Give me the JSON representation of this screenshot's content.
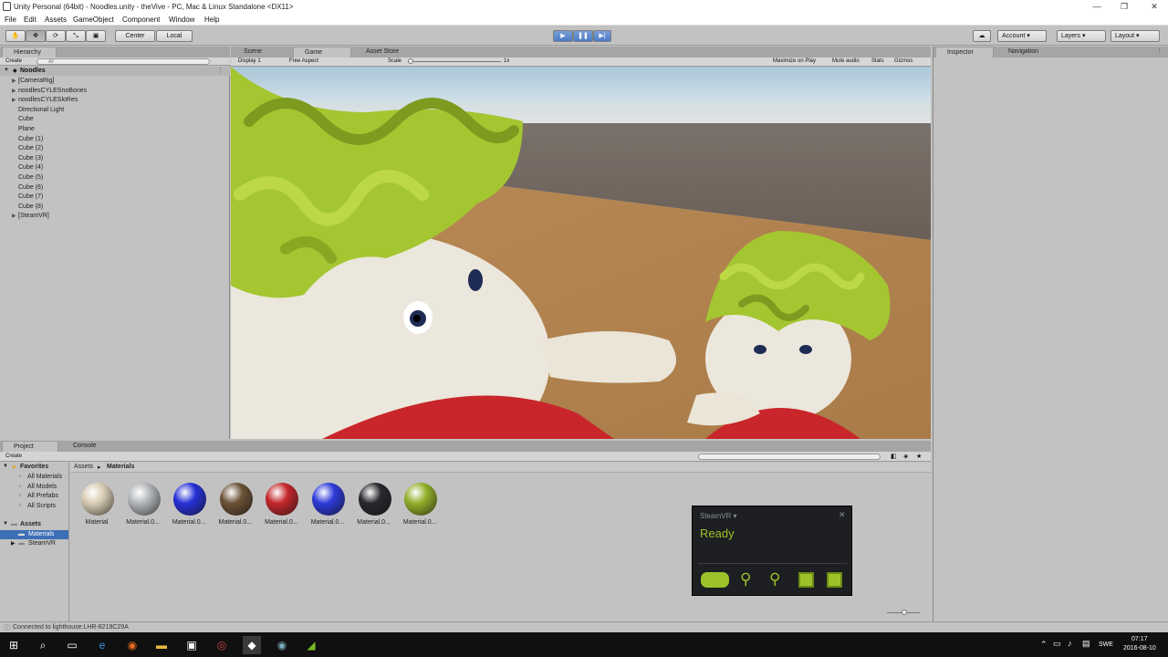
{
  "window": {
    "title": "Unity Personal (64bit) - Noodles.unity - theVive - PC, Mac & Linux Standalone <DX11>",
    "controls": [
      "—",
      "❐",
      "✕"
    ]
  },
  "menu": [
    "File",
    "Edit",
    "Assets",
    "GameObject",
    "Component",
    "Window",
    "Help"
  ],
  "toolbar": {
    "pivot_mode": "Center",
    "pivot_space": "Local",
    "account": "Account",
    "layers": "Layers",
    "layout": "Layout"
  },
  "hierarchy": {
    "tab": "Hierarchy",
    "create": "Create",
    "search_placeholder": "All",
    "scene": "Noodles",
    "items": [
      {
        "label": "[CameraRig]",
        "expandable": true
      },
      {
        "label": "noodlesCYLESnoBones",
        "expandable": true
      },
      {
        "label": "noodlesCYLESloRes",
        "expandable": true
      },
      {
        "label": "Directional Light",
        "expandable": false
      },
      {
        "label": "Cube",
        "expandable": false
      },
      {
        "label": "Plane",
        "expandable": false
      },
      {
        "label": "Cube (1)",
        "expandable": false
      },
      {
        "label": "Cube (2)",
        "expandable": false
      },
      {
        "label": "Cube (3)",
        "expandable": false
      },
      {
        "label": "Cube (4)",
        "expandable": false
      },
      {
        "label": "Cube (5)",
        "expandable": false
      },
      {
        "label": "Cube (6)",
        "expandable": false
      },
      {
        "label": "Cube (7)",
        "expandable": false
      },
      {
        "label": "Cube (8)",
        "expandable": false
      },
      {
        "label": "[SteamVR]",
        "expandable": true
      }
    ]
  },
  "center_tabs": {
    "scene": "Scene",
    "game": "Game",
    "asset_store": "Asset Store"
  },
  "game_bar": {
    "display": "Display 1",
    "aspect": "Free Aspect",
    "scale_label": "Scale",
    "scale_value": "1x",
    "maximize": "Maximize on Play",
    "mute": "Mute audio",
    "stats": "Stats",
    "gizmos": "Gizmos"
  },
  "inspector": {
    "tab": "Inspector",
    "nav_tab": "Navigation"
  },
  "project": {
    "tab": "Project",
    "console_tab": "Console",
    "create": "Create",
    "favorites_title": "Favorites",
    "favorites": [
      "All Materials",
      "All Models",
      "All Prefabs",
      "All Scripts"
    ],
    "assets_title": "Assets",
    "folders": [
      "Materials",
      "SteamVR"
    ],
    "breadcrumb_root": "Assets",
    "breadcrumb_sep": "▸",
    "breadcrumb_current": "Materials",
    "materials": [
      {
        "label": "Material",
        "color": "#d8ccb4"
      },
      {
        "label": "Material.0...",
        "color": "#b3b6ba"
      },
      {
        "label": "Material.0...",
        "color": "#2630d6"
      },
      {
        "label": "Material.0...",
        "color": "#6b5236"
      },
      {
        "label": "Material.0...",
        "color": "#c3272c"
      },
      {
        "label": "Material.0...",
        "color": "#2d3ad8"
      },
      {
        "label": "Material.0...",
        "color": "#26282c"
      },
      {
        "label": "Material.0...",
        "color": "#93b02a"
      }
    ]
  },
  "steamvr": {
    "title": "SteamVR ▾",
    "status": "Ready",
    "accent": "#9cc22a"
  },
  "status_bar": {
    "text": "Connected to lighthouse:LHR-8219C29A"
  },
  "taskbar": {
    "lang": "SWE",
    "time": "07:17",
    "date": "2016-08-10"
  }
}
